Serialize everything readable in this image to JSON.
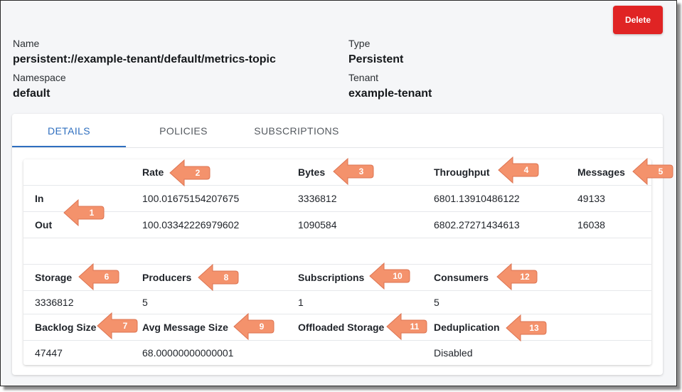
{
  "actions": {
    "delete_label": "Delete"
  },
  "topic": {
    "name_label": "Name",
    "name_value": "persistent://example-tenant/default/metrics-topic",
    "namespace_label": "Namespace",
    "namespace_value": "default",
    "type_label": "Type",
    "type_value": "Persistent",
    "tenant_label": "Tenant",
    "tenant_value": "example-tenant"
  },
  "tabs": [
    {
      "label": "DETAILS",
      "active": true
    },
    {
      "label": "POLICIES",
      "active": false
    },
    {
      "label": "SUBSCRIPTIONS",
      "active": false
    }
  ],
  "rates": {
    "headers": [
      "",
      "Rate",
      "Bytes",
      "Throughput",
      "Messages"
    ],
    "rows": [
      [
        "In",
        "100.01675154207675",
        "3336812",
        "6801.13910486122",
        "49133"
      ],
      [
        "Out",
        "100.03342226979602",
        "1090584",
        "6802.27271434613",
        "16038"
      ]
    ]
  },
  "stats": {
    "storage_label": "Storage",
    "storage_value": "3336812",
    "producers_label": "Producers",
    "producers_value": "5",
    "subscriptions_label": "Subscriptions",
    "subscriptions_value": "1",
    "consumers_label": "Consumers",
    "consumers_value": "5",
    "backlog_label": "Backlog Size",
    "backlog_value": "47447",
    "avg_msg_label": "Avg Message Size",
    "avg_msg_value": "68.00000000000001",
    "offloaded_label": "Offloaded Storage",
    "offloaded_value": "",
    "dedup_label": "Deduplication",
    "dedup_value": "Disabled"
  },
  "callouts": [
    "1",
    "2",
    "3",
    "4",
    "5",
    "6",
    "7",
    "8",
    "9",
    "10",
    "11",
    "12",
    "13"
  ],
  "colors": {
    "accent": "#2f6fbf",
    "danger": "#e02424",
    "callout": "#f4926c"
  }
}
